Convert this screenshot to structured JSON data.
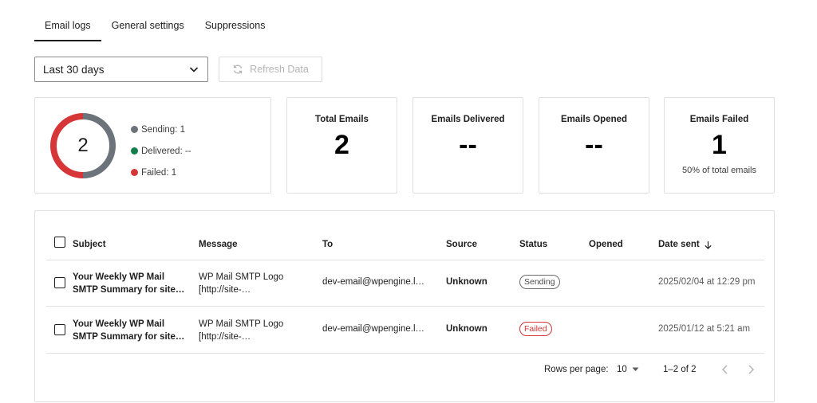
{
  "tabs": [
    {
      "label": "Email logs",
      "active": true
    },
    {
      "label": "General settings",
      "active": false
    },
    {
      "label": "Suppressions",
      "active": false
    }
  ],
  "filter": {
    "range_value": "Last 30 days",
    "refresh_label": "Refresh Data"
  },
  "summary": {
    "donut_total": "2",
    "legend": [
      {
        "label": "Sending: 1",
        "color": "#6d737a"
      },
      {
        "label": "Delivered: --",
        "color": "#137e4b"
      },
      {
        "label": "Failed: 1",
        "color": "#d63638"
      }
    ],
    "segments": {
      "sending": 1,
      "failed": 1
    }
  },
  "stats": [
    {
      "title": "Total Emails",
      "value": "2",
      "sub": ""
    },
    {
      "title": "Emails Delivered",
      "value": "--",
      "sub": ""
    },
    {
      "title": "Emails Opened",
      "value": "--",
      "sub": ""
    },
    {
      "title": "Emails Failed",
      "value": "1",
      "sub": "50% of total emails"
    }
  ],
  "table": {
    "headers": {
      "subject": "Subject",
      "message": "Message",
      "to": "To",
      "source": "Source",
      "status": "Status",
      "opened": "Opened",
      "date_sent": "Date sent"
    },
    "rows": [
      {
        "subject_line1": "Your Weekly WP Mail",
        "subject_line2": "SMTP Summary for site…",
        "message_line1": "WP Mail SMTP Logo",
        "message_line2": "[http://site-…",
        "to": "dev-email@wpengine.l…",
        "source": "Unknown",
        "status": "Sending",
        "opened": "",
        "date": "2025/02/04 at 12:29 pm"
      },
      {
        "subject_line1": "Your Weekly WP Mail",
        "subject_line2": "SMTP Summary for site…",
        "message_line1": "WP Mail SMTP Logo",
        "message_line2": "[http://site-…",
        "to": "dev-email@wpengine.l…",
        "source": "Unknown",
        "status": "Failed",
        "opened": "",
        "date": "2025/01/12 at 5:21 am"
      }
    ]
  },
  "pagination": {
    "rows_per_page_label": "Rows per page:",
    "rows_per_page_value": "10",
    "range": "1–2 of 2"
  },
  "icons": {
    "dropdown": "chevron-down-icon",
    "refresh": "refresh-icon",
    "sort": "arrow-down-icon",
    "prev": "chevron-left-icon",
    "next": "chevron-right-icon"
  }
}
